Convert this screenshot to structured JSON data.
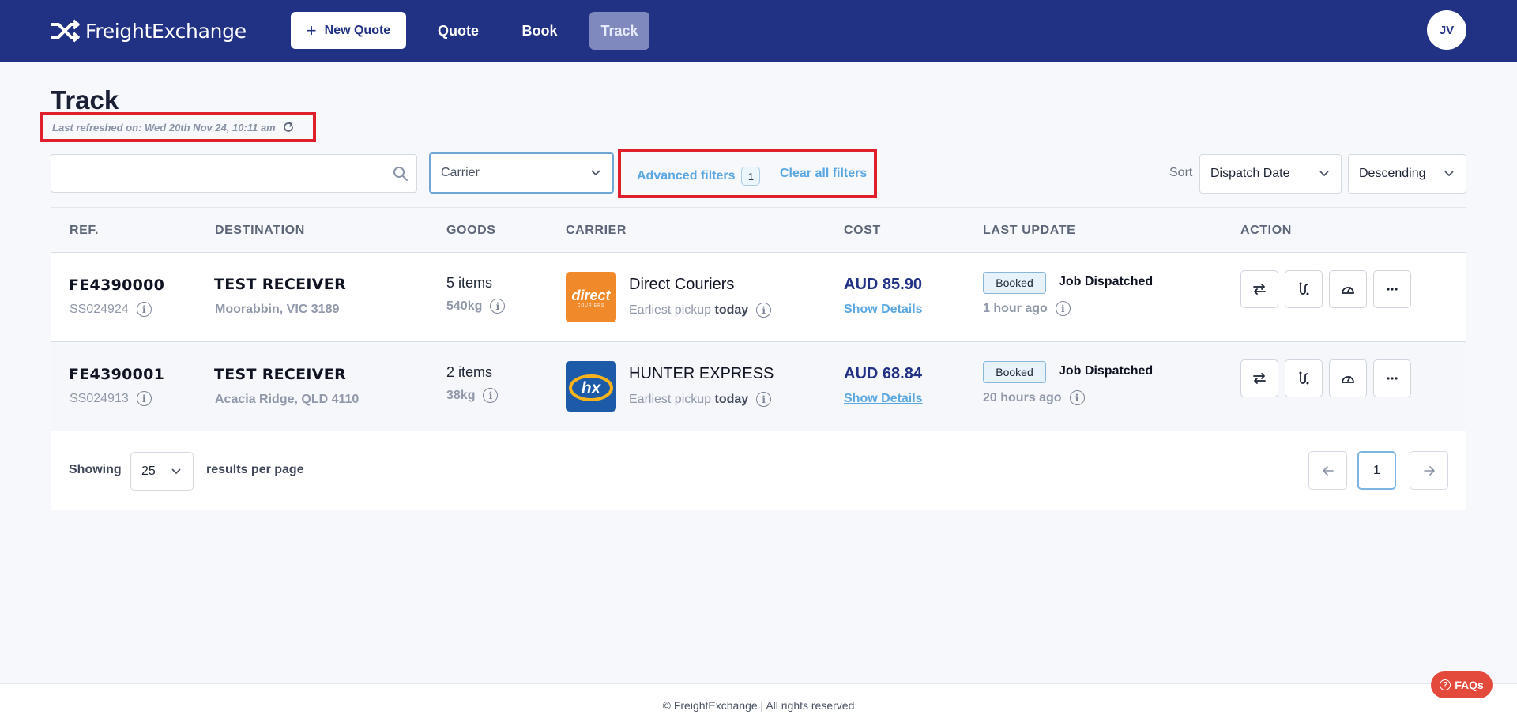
{
  "header": {
    "logo_text": "FreightExchange",
    "new_quote_label": "New Quote",
    "nav": [
      "Quote",
      "Book",
      "Track"
    ],
    "active_nav": "Track",
    "avatar_initials": "JV"
  },
  "page": {
    "title": "Track",
    "last_refreshed": "Last refreshed on: Wed 20th Nov 24, 10:11 am"
  },
  "filters": {
    "search_value": "",
    "carrier_placeholder": "Carrier",
    "advanced_label": "Advanced filters",
    "advanced_count": "1",
    "clear_label": "Clear all filters",
    "sort_label": "Sort",
    "sort_field": "Dispatch Date",
    "sort_order": "Descending"
  },
  "table": {
    "columns": [
      "REF.",
      "DESTINATION",
      "GOODS",
      "CARRIER",
      "COST",
      "LAST UPDATE",
      "ACTION"
    ],
    "rows": [
      {
        "ref": "FE4390000",
        "sub_ref": "SS024924",
        "destination": "TEST RECEIVER",
        "location": "Moorabbin, VIC 3189",
        "items": "5 items",
        "weight": "540kg",
        "carrier": "Direct Couriers",
        "carrier_logo_text": "direct",
        "carrier_logo_sub": "COURIERS",
        "pickup_prefix": "Earliest pickup",
        "pickup_day": "today",
        "cost": "AUD 85.90",
        "details_label": "Show Details",
        "status_badge": "Booked",
        "status_text": "Job Dispatched",
        "updated": "1 hour ago"
      },
      {
        "ref": "FE4390001",
        "sub_ref": "SS024913",
        "destination": "TEST RECEIVER",
        "location": "Acacia Ridge, QLD 4110",
        "items": "2 items",
        "weight": "38kg",
        "carrier": "HUNTER EXPRESS",
        "carrier_logo_text": "hx",
        "pickup_prefix": "Earliest pickup",
        "pickup_day": "today",
        "cost": "AUD 68.84",
        "details_label": "Show Details",
        "status_badge": "Booked",
        "status_text": "Job Dispatched",
        "updated": "20 hours ago"
      }
    ]
  },
  "pagination": {
    "showing_label": "Showing",
    "per_page": "25",
    "results_label": "results per page",
    "current_page": "1"
  },
  "footer": {
    "copyright": "© FreightExchange | All rights reserved",
    "faq_label": "FAQs"
  },
  "colors": {
    "brand": "#213183",
    "accent": "#5aa7e2",
    "highlight": "#e01f2c"
  }
}
